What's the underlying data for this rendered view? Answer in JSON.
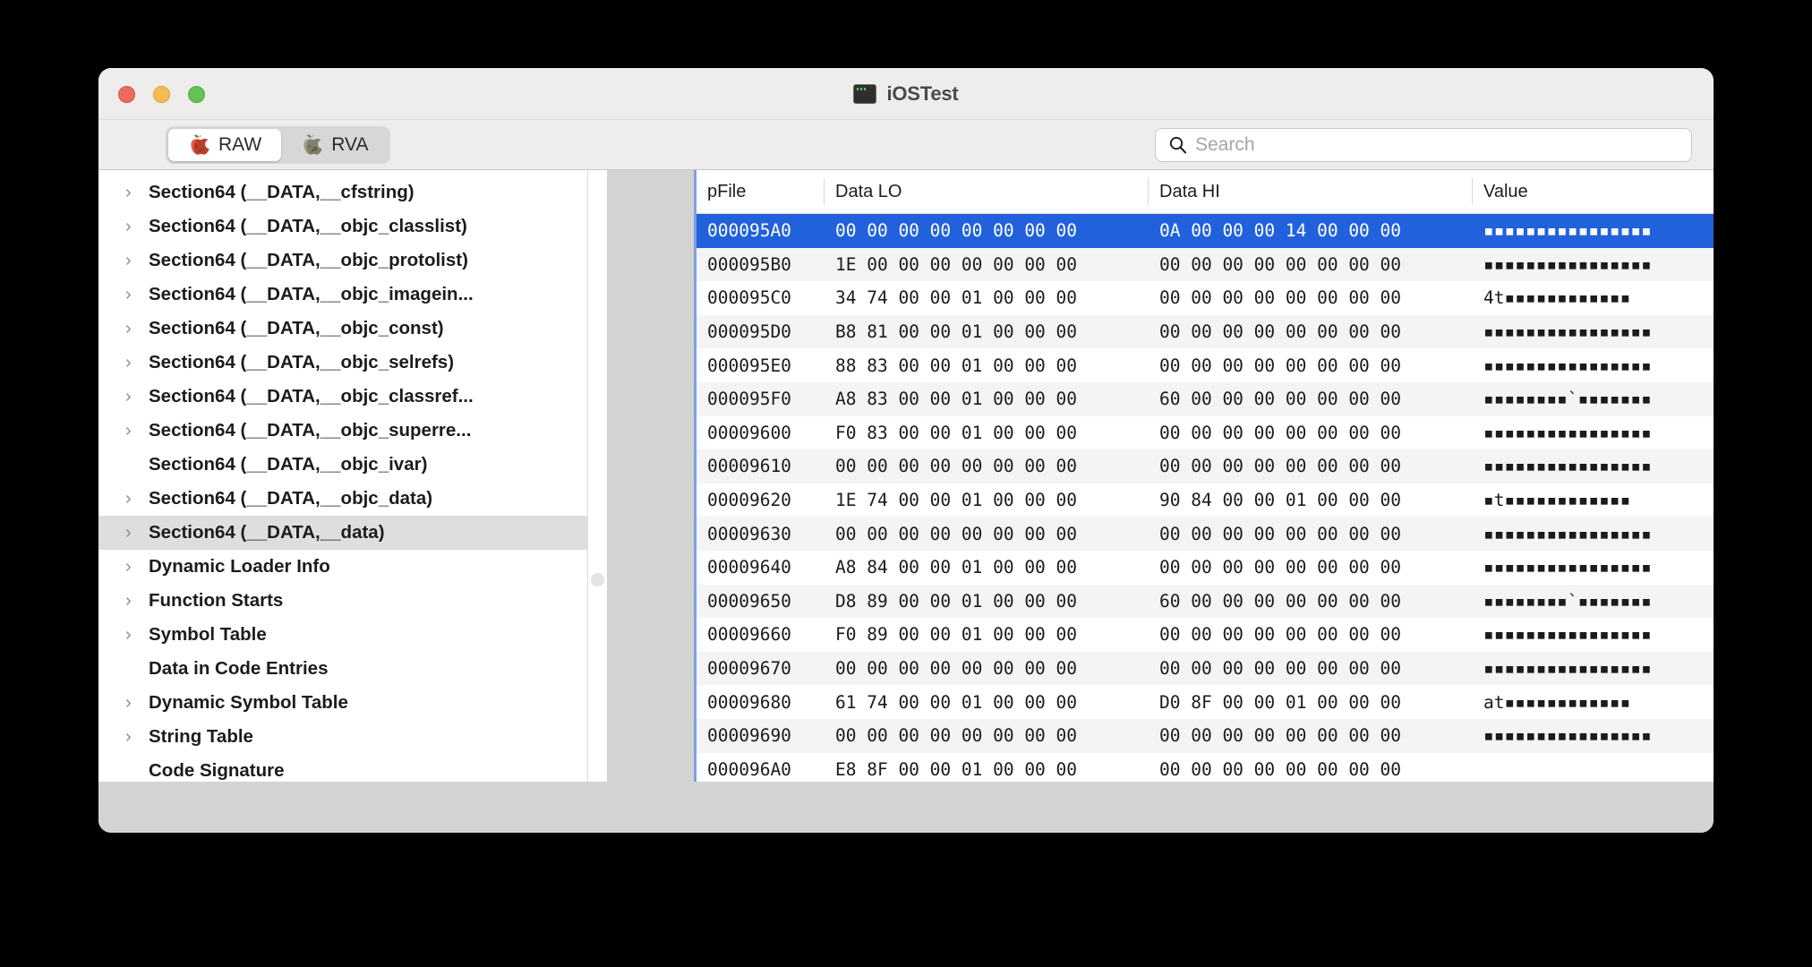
{
  "window": {
    "title": "iOSTest",
    "app_icon": "terminal-icon",
    "traffic_lights": [
      {
        "name": "close-button",
        "color": "#ee6a5f"
      },
      {
        "name": "minimize-button",
        "color": "#f5bd4f"
      },
      {
        "name": "maximize-button",
        "color": "#61c454"
      }
    ]
  },
  "toolbar": {
    "tabs": [
      {
        "label": "RAW",
        "icon": "red-apple-icon",
        "active": true
      },
      {
        "label": "RVA",
        "icon": "gray-apple-icon",
        "active": false
      }
    ],
    "search": {
      "icon": "search-icon",
      "value": "",
      "placeholder": "Search"
    }
  },
  "sidebar": {
    "items": [
      {
        "label": "Section64 (__DATA,__cfstring)",
        "expandable": true,
        "selected": false
      },
      {
        "label": "Section64 (__DATA,__objc_classlist)",
        "expandable": true,
        "selected": false
      },
      {
        "label": "Section64 (__DATA,__objc_protolist)",
        "expandable": true,
        "selected": false
      },
      {
        "label": "Section64 (__DATA,__objc_imagein...",
        "expandable": true,
        "selected": false
      },
      {
        "label": "Section64 (__DATA,__objc_const)",
        "expandable": true,
        "selected": false
      },
      {
        "label": "Section64 (__DATA,__objc_selrefs)",
        "expandable": true,
        "selected": false
      },
      {
        "label": "Section64 (__DATA,__objc_classref...",
        "expandable": true,
        "selected": false
      },
      {
        "label": "Section64 (__DATA,__objc_superre...",
        "expandable": true,
        "selected": false
      },
      {
        "label": "Section64 (__DATA,__objc_ivar)",
        "expandable": false,
        "selected": false
      },
      {
        "label": "Section64 (__DATA,__objc_data)",
        "expandable": true,
        "selected": false
      },
      {
        "label": "Section64 (__DATA,__data)",
        "expandable": true,
        "selected": true
      },
      {
        "label": "Dynamic Loader Info",
        "expandable": true,
        "selected": false
      },
      {
        "label": "Function Starts",
        "expandable": true,
        "selected": false
      },
      {
        "label": "Symbol Table",
        "expandable": true,
        "selected": false
      },
      {
        "label": "Data in Code Entries",
        "expandable": false,
        "selected": false
      },
      {
        "label": "Dynamic Symbol Table",
        "expandable": true,
        "selected": false
      },
      {
        "label": "String Table",
        "expandable": true,
        "selected": false
      },
      {
        "label": "Code Signature",
        "expandable": false,
        "selected": false
      }
    ],
    "chevron_glyph": "›",
    "splitter_handle": "splitter-handle"
  },
  "table": {
    "columns": [
      "pFile",
      "Data LO",
      "Data HI",
      "Value"
    ],
    "rows": [
      {
        "pfile": "000095A0",
        "lo": "00 00 00 00 00 00 00 00",
        "hi": "0A 00 00 00 14 00 00 00",
        "value": "▪▪▪▪▪▪▪▪▪▪▪▪▪▪▪▪",
        "selected": true
      },
      {
        "pfile": "000095B0",
        "lo": "1E 00 00 00 00 00 00 00",
        "hi": "00 00 00 00 00 00 00 00",
        "value": "▪▪▪▪▪▪▪▪▪▪▪▪▪▪▪▪",
        "selected": false
      },
      {
        "pfile": "000095C0",
        "lo": "34 74 00 00 01 00 00 00",
        "hi": "00 00 00 00 00 00 00 00",
        "value": "4t▪▪▪▪▪▪▪▪▪▪▪▪",
        "selected": false
      },
      {
        "pfile": "000095D0",
        "lo": "B8 81 00 00 01 00 00 00",
        "hi": "00 00 00 00 00 00 00 00",
        "value": "▪▪▪▪▪▪▪▪▪▪▪▪▪▪▪▪",
        "selected": false
      },
      {
        "pfile": "000095E0",
        "lo": "88 83 00 00 01 00 00 00",
        "hi": "00 00 00 00 00 00 00 00",
        "value": "▪▪▪▪▪▪▪▪▪▪▪▪▪▪▪▪",
        "selected": false
      },
      {
        "pfile": "000095F0",
        "lo": "A8 83 00 00 01 00 00 00",
        "hi": "60 00 00 00 00 00 00 00",
        "value": "▪▪▪▪▪▪▪▪`▪▪▪▪▪▪▪",
        "selected": false
      },
      {
        "pfile": "00009600",
        "lo": "F0 83 00 00 01 00 00 00",
        "hi": "00 00 00 00 00 00 00 00",
        "value": "▪▪▪▪▪▪▪▪▪▪▪▪▪▪▪▪",
        "selected": false
      },
      {
        "pfile": "00009610",
        "lo": "00 00 00 00 00 00 00 00",
        "hi": "00 00 00 00 00 00 00 00",
        "value": "▪▪▪▪▪▪▪▪▪▪▪▪▪▪▪▪",
        "selected": false
      },
      {
        "pfile": "00009620",
        "lo": "1E 74 00 00 01 00 00 00",
        "hi": "90 84 00 00 01 00 00 00",
        "value": "▪t▪▪▪▪▪▪▪▪▪▪▪▪",
        "selected": false
      },
      {
        "pfile": "00009630",
        "lo": "00 00 00 00 00 00 00 00",
        "hi": "00 00 00 00 00 00 00 00",
        "value": "▪▪▪▪▪▪▪▪▪▪▪▪▪▪▪▪",
        "selected": false
      },
      {
        "pfile": "00009640",
        "lo": "A8 84 00 00 01 00 00 00",
        "hi": "00 00 00 00 00 00 00 00",
        "value": "▪▪▪▪▪▪▪▪▪▪▪▪▪▪▪▪",
        "selected": false
      },
      {
        "pfile": "00009650",
        "lo": "D8 89 00 00 01 00 00 00",
        "hi": "60 00 00 00 00 00 00 00",
        "value": "▪▪▪▪▪▪▪▪`▪▪▪▪▪▪▪",
        "selected": false
      },
      {
        "pfile": "00009660",
        "lo": "F0 89 00 00 01 00 00 00",
        "hi": "00 00 00 00 00 00 00 00",
        "value": "▪▪▪▪▪▪▪▪▪▪▪▪▪▪▪▪",
        "selected": false
      },
      {
        "pfile": "00009670",
        "lo": "00 00 00 00 00 00 00 00",
        "hi": "00 00 00 00 00 00 00 00",
        "value": "▪▪▪▪▪▪▪▪▪▪▪▪▪▪▪▪",
        "selected": false
      },
      {
        "pfile": "00009680",
        "lo": "61 74 00 00 01 00 00 00",
        "hi": "D0 8F 00 00 01 00 00 00",
        "value": "at▪▪▪▪▪▪▪▪▪▪▪▪",
        "selected": false
      },
      {
        "pfile": "00009690",
        "lo": "00 00 00 00 00 00 00 00",
        "hi": "00 00 00 00 00 00 00 00",
        "value": "▪▪▪▪▪▪▪▪▪▪▪▪▪▪▪▪",
        "selected": false
      },
      {
        "pfile": "000096A0",
        "lo": "E8 8F 00 00 01 00 00 00",
        "hi": "00 00 00 00 00 00 00 00",
        "value": "",
        "selected": false
      }
    ]
  },
  "colors": {
    "selection_blue": "#2161db",
    "focus_ring": "#7d9fe8",
    "sidebar_selected": "#dededd",
    "chrome": "#eeedeb"
  }
}
